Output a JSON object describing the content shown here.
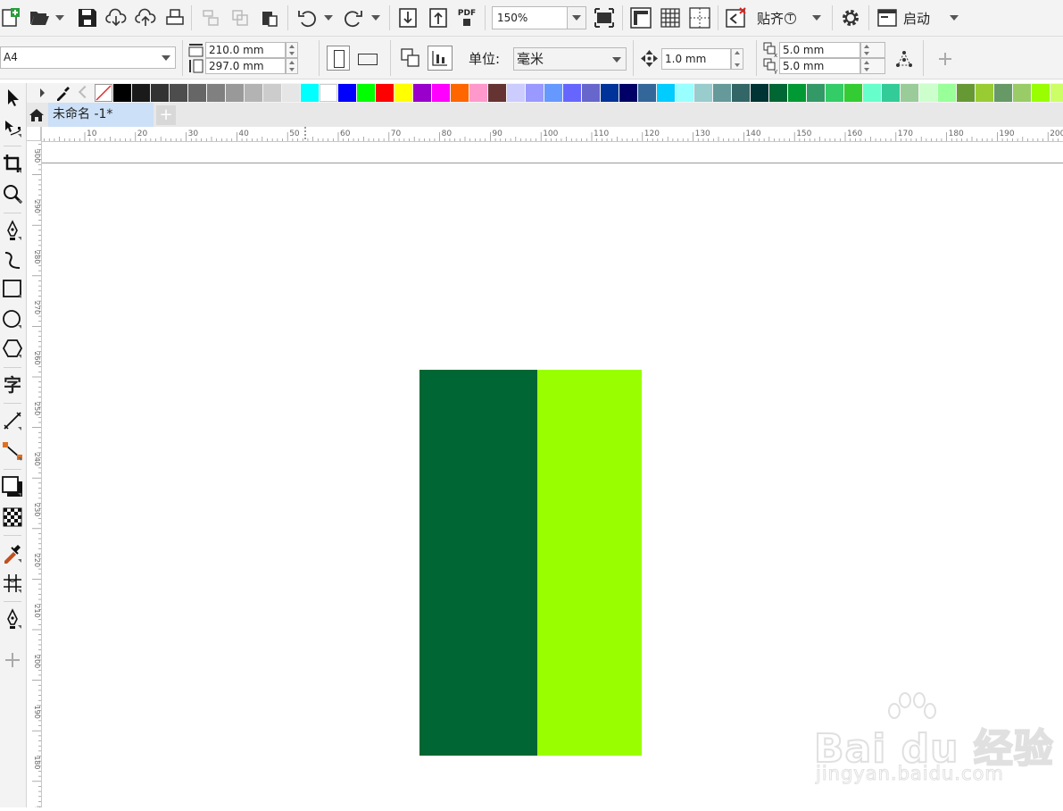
{
  "toolbar": {
    "zoom_value": "150%",
    "snap_label": "贴齐",
    "snap_hotkey": "T",
    "launch_label": "启动",
    "pdf_label": "PDF"
  },
  "property_bar": {
    "page_size": "A4",
    "width": "210.0 mm",
    "height": "297.0 mm",
    "unit_label": "单位:",
    "unit_value": "毫米",
    "nudge": "1.0 mm",
    "dup_x": "5.0 mm",
    "dup_y": "5.0 mm"
  },
  "tab": {
    "title": "未命名 -1*"
  },
  "palette_colors": [
    "#000000",
    "#1a1a1a",
    "#333333",
    "#4d4d4d",
    "#666666",
    "#808080",
    "#999999",
    "#b3b3b3",
    "#cccccc",
    "#e6e6e6",
    "#00ffff",
    "#ffffff",
    "#0000ff",
    "#00ff00",
    "#ff0000",
    "#ffff00",
    "#9900cc",
    "#ff00ff",
    "#ff6600",
    "#ff99cc",
    "#663333",
    "#ccccff",
    "#9999ff",
    "#6699ff",
    "#6666ff",
    "#6666cc",
    "#003399",
    "#000066",
    "#336699",
    "#00ccff",
    "#99ffff",
    "#99cccc",
    "#669999",
    "#336666",
    "#003333",
    "#006633",
    "#009933",
    "#339966",
    "#33cc66",
    "#33cc33",
    "#66ffcc",
    "#33cc99",
    "#99cc99",
    "#ccffcc",
    "#99ff99",
    "#669933",
    "#99cc33",
    "#669966",
    "#99cc66",
    "#99ff00",
    "#ccff66"
  ],
  "ruler_h_labels": [
    "10",
    "20",
    "30",
    "40",
    "50",
    "60",
    "70",
    "80",
    "90",
    "100",
    "110",
    "120",
    "130",
    "140",
    "150",
    "160",
    "170",
    "180",
    "190",
    "200"
  ],
  "ruler_v_labels": [
    "300",
    "290",
    "280",
    "270",
    "260",
    "250",
    "240",
    "230",
    "220",
    "210",
    "200",
    "190",
    "180",
    "170"
  ],
  "shapes": {
    "dark_fill": "#006633",
    "light_fill": "#99ff00"
  },
  "watermark": {
    "main": "Bai du 经验",
    "sub": "jingyan.baidu.com"
  }
}
